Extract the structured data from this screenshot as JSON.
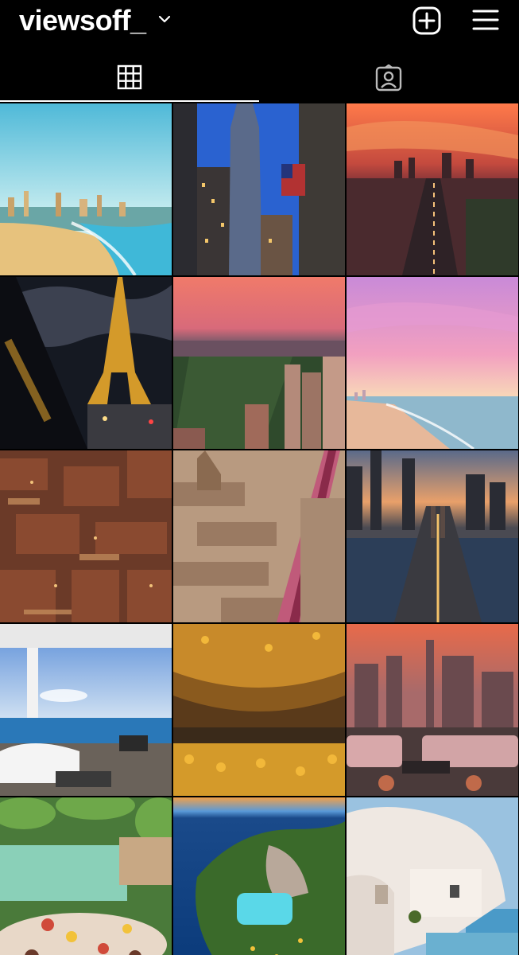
{
  "header": {
    "username": "viewsoff_",
    "account_switcher_icon": "chevron-down-icon",
    "new_post_icon": "plus-square-icon",
    "menu_icon": "hamburger-menu-icon"
  },
  "tabs": [
    {
      "icon": "grid-icon",
      "active": true
    },
    {
      "icon": "tagged-user-icon",
      "active": false
    }
  ],
  "posts": [
    {
      "scene": "beach-skyline"
    },
    {
      "scene": "skyscrapers-flags"
    },
    {
      "scene": "sunset-city-highway"
    },
    {
      "scene": "eiffel-tower-night"
    },
    {
      "scene": "central-park-sunset"
    },
    {
      "scene": "pink-sunset-beach"
    },
    {
      "scene": "old-city-rooftops"
    },
    {
      "scene": "aerial-blossom-city"
    },
    {
      "scene": "bridge-skyline-dusk"
    },
    {
      "scene": "ocean-view-bedroom"
    },
    {
      "scene": "sunflower-tunnel"
    },
    {
      "scene": "rooftop-terrace-skyline"
    },
    {
      "scene": "jungle-pool-breakfast"
    },
    {
      "scene": "cliff-pool-coast"
    },
    {
      "scene": "white-cliff-house"
    }
  ]
}
